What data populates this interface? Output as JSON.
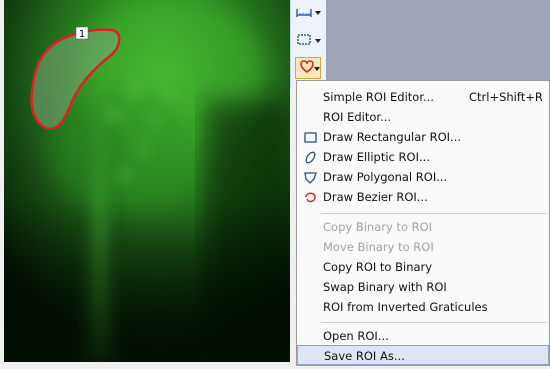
{
  "roi_label": "1",
  "colors": {
    "fluorescence": "#3dbb2a",
    "roi_outline": "#e02020",
    "menu_highlight": "#dce6f4",
    "disabled_text": "#a3a3a3"
  },
  "toolbar": {
    "buttons": [
      {
        "icon": "ruler-icon"
      },
      {
        "icon": "rectangle-select-icon"
      },
      {
        "icon": "roi-shapes-icon"
      }
    ]
  },
  "menu": {
    "items": [
      {
        "label": "Simple ROI Editor...",
        "shortcut": "Ctrl+Shift+R",
        "icon": "",
        "disabled": false
      },
      {
        "label": "ROI Editor...",
        "shortcut": "",
        "icon": "",
        "disabled": false
      },
      {
        "label": "Draw Rectangular ROI...",
        "shortcut": "",
        "icon": "rectangle-icon",
        "disabled": false
      },
      {
        "label": "Draw Elliptic ROI...",
        "shortcut": "",
        "icon": "ellipse-icon",
        "disabled": false
      },
      {
        "label": "Draw Polygonal ROI...",
        "shortcut": "",
        "icon": "polygon-icon",
        "disabled": false
      },
      {
        "label": "Draw Bezier ROI...",
        "shortcut": "",
        "icon": "bezier-icon",
        "disabled": false
      },
      {
        "label": "Copy Binary to ROI",
        "shortcut": "",
        "icon": "",
        "disabled": true
      },
      {
        "label": "Move Binary to ROI",
        "shortcut": "",
        "icon": "",
        "disabled": true
      },
      {
        "label": "Copy ROI to Binary",
        "shortcut": "",
        "icon": "",
        "disabled": false
      },
      {
        "label": "Swap Binary with ROI",
        "shortcut": "",
        "icon": "",
        "disabled": false
      },
      {
        "label": "ROI from Inverted Graticules",
        "shortcut": "",
        "icon": "",
        "disabled": false
      },
      {
        "label": "Open ROI...",
        "shortcut": "",
        "icon": "",
        "disabled": false
      },
      {
        "label": "Save ROI As...",
        "shortcut": "",
        "icon": "",
        "disabled": false,
        "highlighted": true
      }
    ]
  }
}
